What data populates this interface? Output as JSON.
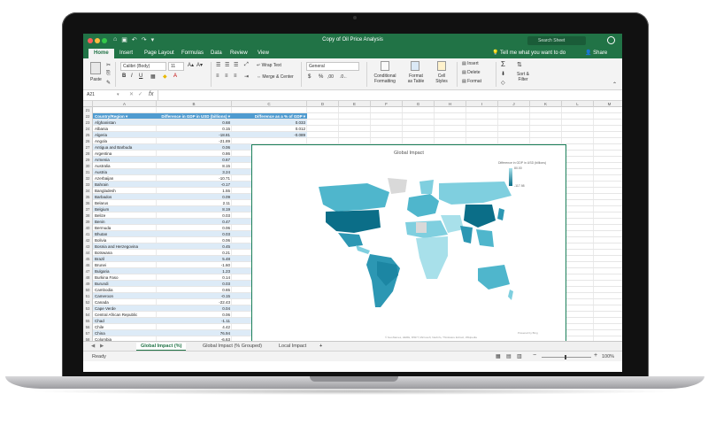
{
  "window": {
    "title": "Copy of Oil Price Analysis",
    "search_placeholder": "Search Sheet"
  },
  "colors": {
    "excel_green": "#217346",
    "band_blue": "#ddebf7",
    "header_blue": "#4f9bd0",
    "map_dark": "#0b6e88",
    "map_light": "#a8e0ea"
  },
  "tabs": [
    "Home",
    "Insert",
    "Page Layout",
    "Formulas",
    "Data",
    "Review",
    "View"
  ],
  "tell_me": "Tell me what you want to do",
  "share": "Share",
  "ribbon": {
    "paste": "Paste",
    "font_name": "Calibri (Body)",
    "font_size": "11",
    "wrap_text": "Wrap Text",
    "merge_center": "Merge & Center",
    "number_format": "General",
    "conditional_formatting": "Conditional\nFormatting",
    "format_as_table": "Format\nas Table",
    "cell_styles": "Cell\nStyles",
    "insert": "Insert",
    "delete": "Delete",
    "format": "Format",
    "sort_filter": "Sort &\nFilter",
    "bold": "B",
    "italic": "I",
    "underline": "U"
  },
  "formula_bar": {
    "name_box": "A21",
    "fx": "fx"
  },
  "columns": [
    "A",
    "B",
    "C",
    "D",
    "E",
    "F",
    "G",
    "H",
    "I",
    "J",
    "K",
    "L",
    "M",
    "N",
    "O"
  ],
  "table": {
    "headers": [
      "Country/Region",
      "Difference in GDP in USD (billions)",
      "Difference as a % of GDP"
    ],
    "header_row": "22",
    "first_row_num": "21",
    "rows": [
      [
        "23",
        "Afghanistan",
        "0.68",
        "0.033"
      ],
      [
        "24",
        "Albania",
        "0.15",
        "0.012"
      ],
      [
        "25",
        "Algeria",
        "-18.81",
        "-0.089"
      ],
      [
        "26",
        "Angola",
        "-21.89",
        ""
      ],
      [
        "27",
        "Antigua and Barbuda",
        "0.06",
        ""
      ],
      [
        "28",
        "Argentina",
        "0.86",
        ""
      ],
      [
        "29",
        "Armenia",
        "0.67",
        ""
      ],
      [
        "30",
        "Australia",
        "8.15",
        ""
      ],
      [
        "31",
        "Austria",
        "3.24",
        ""
      ],
      [
        "32",
        "Azerbaijan",
        "-10.71",
        ""
      ],
      [
        "33",
        "Bahrain",
        "-0.17",
        ""
      ],
      [
        "34",
        "Bangladesh",
        "1.55",
        ""
      ],
      [
        "35",
        "Barbados",
        "0.09",
        ""
      ],
      [
        "36",
        "Belarus",
        "2.11",
        ""
      ],
      [
        "37",
        "Belgium",
        "8.19",
        ""
      ],
      [
        "38",
        "Belize",
        "0.03",
        ""
      ],
      [
        "39",
        "Benin",
        "0.47",
        ""
      ],
      [
        "40",
        "Bermuda",
        "0.06",
        ""
      ],
      [
        "41",
        "Bhutan",
        "0.03",
        ""
      ],
      [
        "42",
        "Bolivia",
        "0.06",
        ""
      ],
      [
        "43",
        "Bosnia and Herzegovina",
        "0.45",
        ""
      ],
      [
        "44",
        "Botswana",
        "0.21",
        ""
      ],
      [
        "45",
        "Brazil",
        "5.48",
        ""
      ],
      [
        "46",
        "Brunei",
        "-1.60",
        ""
      ],
      [
        "47",
        "Bulgaria",
        "1.23",
        ""
      ],
      [
        "48",
        "Burkina Faso",
        "0.14",
        ""
      ],
      [
        "49",
        "Burundi",
        "0.03",
        ""
      ],
      [
        "50",
        "Cambodia",
        "0.65",
        ""
      ],
      [
        "51",
        "Cameroon",
        "-0.15",
        ""
      ],
      [
        "52",
        "Canada",
        "-22.43",
        ""
      ],
      [
        "53",
        "Cape Verde",
        "0.04",
        ""
      ],
      [
        "54",
        "Central African Republic",
        "0.06",
        ""
      ],
      [
        "55",
        "Chad",
        "-1.11",
        ""
      ],
      [
        "56",
        "Chile",
        "4.42",
        ""
      ],
      [
        "57",
        "China",
        "76.94",
        ""
      ],
      [
        "58",
        "Colombia",
        "-6.63",
        "-0.026"
      ]
    ]
  },
  "chart": {
    "title": "Global Impact",
    "legend_title": "Difference in GDP in USD (billions)",
    "legend_max": "80.00",
    "legend_min": "-117.98",
    "credit_right": "Powered by Bing",
    "credit_bottom": "© GeoNames, HERE, MSFT, Microsoft, NavInfo, Thinkware Extract, Wikipedia"
  },
  "sheet_tabs": [
    "Global Impact (%)",
    "Global Impact (% Grouped)",
    "Local Impact"
  ],
  "add_sheet": "+",
  "status": {
    "ready": "Ready",
    "zoom": "100%"
  }
}
